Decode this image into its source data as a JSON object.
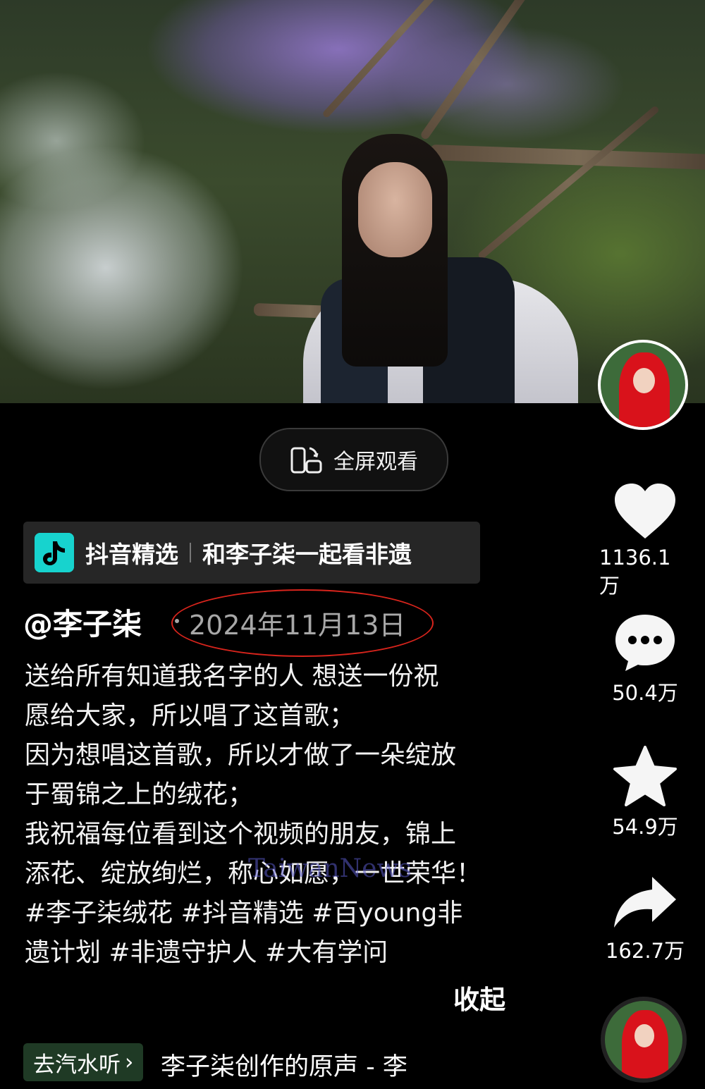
{
  "fullscreen": {
    "label": "全屏观看"
  },
  "collection": {
    "app": "抖音精选",
    "title": "和李子柒一起看非遗"
  },
  "post": {
    "author": "@李子柒",
    "date": "2024年11月13日",
    "description_lines": [
      "送给所有知道我名字的人 想送一份祝",
      "愿给大家，所以唱了这首歌；",
      "因为想唱这首歌，所以才做了一朵绽放",
      "于蜀锦之上的绒花；",
      "我祝福每位看到这个视频的朋友，锦上",
      "添花、绽放绚烂，称心如愿，一世荣华！",
      "#李子柒绒花  #抖音精选  #百young非",
      "遗计划   #非遗守护人   #大有学问"
    ],
    "collapse_label": "收起"
  },
  "music": {
    "tag": "去汽水听",
    "text": "李子柒创作的原声 - 李"
  },
  "watermark": "TaiwanNews",
  "actions": {
    "likes": "1136.1万",
    "comments": "50.4万",
    "favorites": "54.9万",
    "shares": "162.7万"
  },
  "colors": {
    "highlight_circle": "#d8241c",
    "background": "#000000"
  }
}
